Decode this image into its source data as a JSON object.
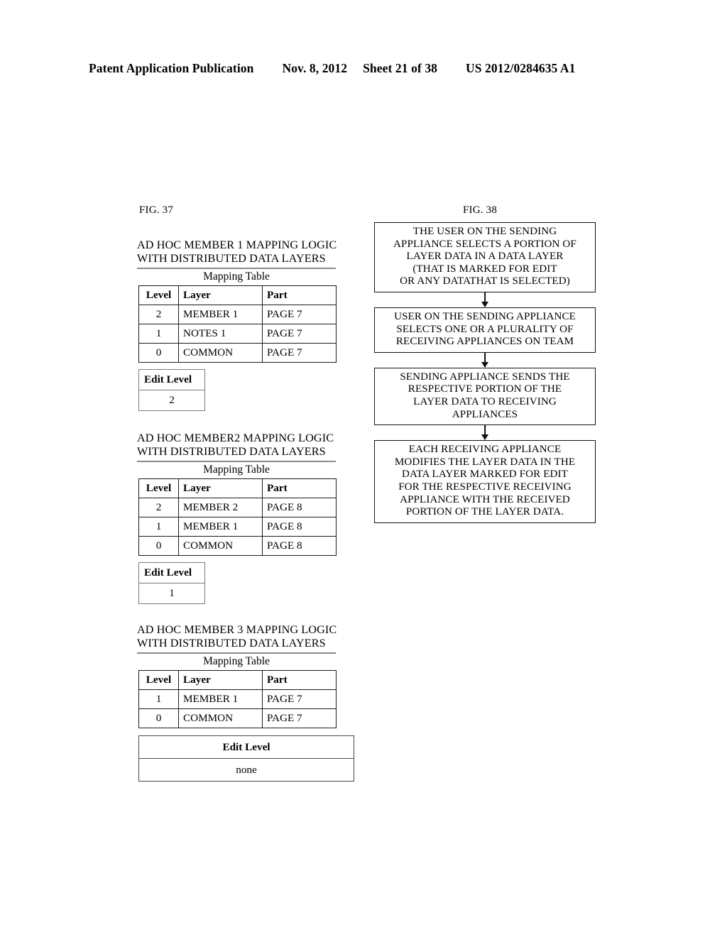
{
  "header": {
    "publication": "Patent Application Publication",
    "date": "Nov. 8, 2012",
    "sheet": "Sheet 21 of 38",
    "patent_number": "US 2012/0284635 A1"
  },
  "fig37": {
    "label": "FIG. 37",
    "sections": [
      {
        "title": "AD HOC MEMBER 1  MAPPING LOGIC\nWITH DISTRIBUTED DATA LAYERS",
        "table_caption": "Mapping Table",
        "columns": [
          "Level",
          "Layer",
          "Part"
        ],
        "rows": [
          [
            "2",
            "MEMBER 1",
            "PAGE 7"
          ],
          [
            "1",
            "NOTES 1",
            "PAGE 7"
          ],
          [
            "0",
            "COMMON",
            "PAGE 7"
          ]
        ],
        "edit_level_label": "Edit Level",
        "edit_level_value": "2"
      },
      {
        "title": "AD HOC MEMBER2  MAPPING LOGIC\nWITH DISTRIBUTED DATA LAYERS",
        "table_caption": "Mapping Table",
        "columns": [
          "Level",
          "Layer",
          "Part"
        ],
        "rows": [
          [
            "2",
            "MEMBER 2",
            "PAGE 8"
          ],
          [
            "1",
            "MEMBER 1",
            "PAGE 8"
          ],
          [
            "0",
            "COMMON",
            "PAGE 8"
          ]
        ],
        "edit_level_label": "Edit Level",
        "edit_level_value": "1"
      },
      {
        "title": "AD HOC MEMBER 3  MAPPING LOGIC\nWITH DISTRIBUTED DATA LAYERS",
        "table_caption": "Mapping Table",
        "columns": [
          "Level",
          "Layer",
          "Part"
        ],
        "rows": [
          [
            "1",
            "MEMBER 1",
            "PAGE 7"
          ],
          [
            "0",
            "COMMON",
            "PAGE 7"
          ]
        ],
        "edit_level_label": "Edit Level",
        "edit_level_value": "none"
      }
    ]
  },
  "fig38": {
    "label": "FIG. 38",
    "steps": [
      "THE USER ON THE SENDING\nAPPLIANCE SELECTS A PORTION OF\nLAYER DATA IN A DATA LAYER\n(THAT IS MARKED FOR EDIT\nOR ANY DATATHAT IS SELECTED)",
      "USER ON THE SENDING APPLIANCE\nSELECTS ONE OR A PLURALITY OF\nRECEIVING APPLIANCES ON TEAM",
      "SENDING APPLIANCE SENDS THE\nRESPECTIVE PORTION OF THE\nLAYER DATA TO RECEIVING\nAPPLIANCES",
      "EACH RECEIVING APPLIANCE\nMODIFIES THE LAYER DATA IN THE\nDATA LAYER MARKED FOR EDIT\nFOR THE RESPECTIVE RECEIVING\nAPPLIANCE WITH THE RECEIVED\nPORTION OF THE LAYER DATA."
    ]
  }
}
